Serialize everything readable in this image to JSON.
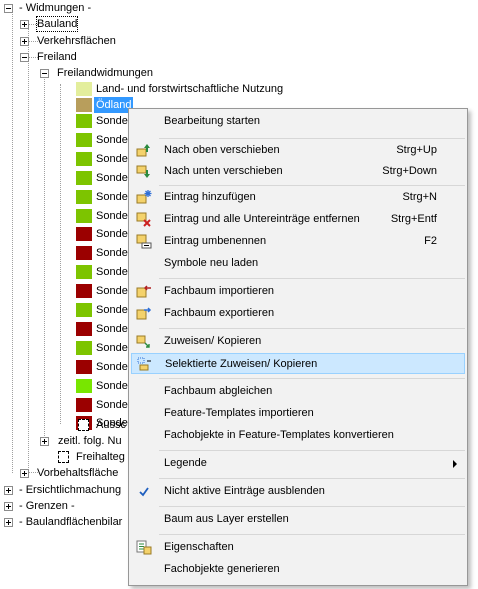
{
  "tree": {
    "widmungen": "- Widmungen -",
    "bauland": "Bauland",
    "verkehrsflaechen": "Verkehrsflächen",
    "freiland": "Freiland",
    "freilandwidmungen": "Freilandwidmungen",
    "land_forst": "Land- und forstwirtschaftliche Nutzung",
    "oedland": "Ödland",
    "sonde_label": "Sonde",
    "sonde_colors": [
      "#7dc400",
      "#7dc400",
      "#7dc400",
      "#7dc400",
      "#7dc400",
      "#7dc400",
      "#9b0000",
      "#9b0000",
      "#7dc400",
      "#9b0000",
      "#7dc400",
      "#9b0000",
      "#7dc400",
      "#9b0000",
      "#78e600",
      "#9b0000",
      "#9b0000"
    ],
    "aussc": "Aussc",
    "zeitl": "zeitl. folg. Nu",
    "freihalte": "Freihalteg",
    "vorbehalt": "Vorbehaltsfläche",
    "ersichtlich": "- Ersichtlichmachung",
    "grenzen": "- Grenzen -",
    "baulandflaechen": "- Baulandflächenbilar",
    "land_forst_color": "#e3ee9c",
    "oedland_color": "#b89e5c"
  },
  "menu": {
    "items": [
      {
        "label": "Bearbeitung starten",
        "shortcut": "",
        "icon": ""
      },
      {
        "label": "Nach oben verschieben",
        "shortcut": "Strg+Up",
        "icon": "move-up-icon"
      },
      {
        "label": "Nach unten verschieben",
        "shortcut": "Strg+Down",
        "icon": "move-down-icon"
      },
      {
        "label": "Eintrag hinzufügen",
        "shortcut": "Strg+N",
        "icon": "add-entry-icon"
      },
      {
        "label": "Eintrag und alle Untereinträge entfernen",
        "shortcut": "Strg+Entf",
        "icon": "remove-entry-icon"
      },
      {
        "label": "Eintrag umbenennen",
        "shortcut": "F2",
        "icon": "rename-entry-icon"
      },
      {
        "label": "Symbole neu laden",
        "shortcut": "",
        "icon": ""
      },
      {
        "label": "Fachbaum importieren",
        "shortcut": "",
        "icon": "import-tree-icon"
      },
      {
        "label": "Fachbaum exportieren",
        "shortcut": "",
        "icon": "export-tree-icon"
      },
      {
        "label": "Zuweisen/ Kopieren",
        "shortcut": "",
        "icon": "assign-copy-icon"
      },
      {
        "label": "Selektierte Zuweisen/ Kopieren",
        "shortcut": "",
        "icon": "assign-selected-icon"
      },
      {
        "label": "Fachbaum abgleichen",
        "shortcut": "",
        "icon": ""
      },
      {
        "label": "Feature-Templates importieren",
        "shortcut": "",
        "icon": ""
      },
      {
        "label": "Fachobjekte in Feature-Templates konvertieren",
        "shortcut": "",
        "icon": ""
      },
      {
        "label": "Legende",
        "shortcut": "",
        "icon": ""
      },
      {
        "label": "Nicht aktive Einträge ausblenden",
        "shortcut": "",
        "icon": "checkmark-icon"
      },
      {
        "label": "Baum aus Layer erstellen",
        "shortcut": "",
        "icon": ""
      },
      {
        "label": "Eigenschaften",
        "shortcut": "",
        "icon": "properties-icon"
      },
      {
        "label": "Fachobjekte generieren",
        "shortcut": "",
        "icon": ""
      }
    ]
  },
  "colors": {
    "selection": "#3399ff",
    "menu_highlight": "#cce8ff",
    "green": "#7dc400",
    "darkred": "#9b0000"
  }
}
